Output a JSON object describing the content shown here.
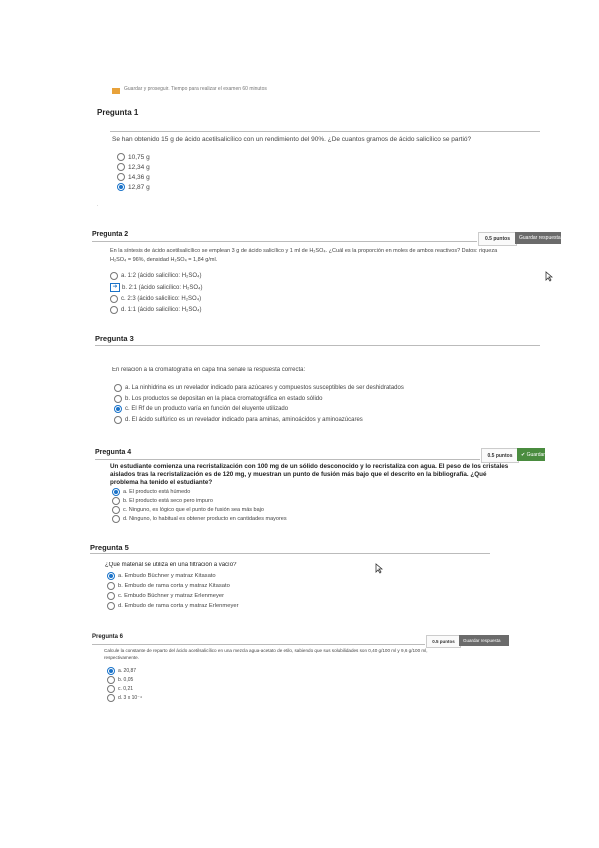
{
  "header_note": "Guardar y proseguir. Tiempo para realizar el examen 60 minutos",
  "q1": {
    "title": "Pregunta 1",
    "stem": "Se han obtenido 15 g de ácido acetilsalicílico con un rendimiento del 90%. ¿De cuantos gramos de ácido salicílico se partió?",
    "options": [
      "10,75 g",
      "12,34 g",
      "14,36 g",
      "12,87 g"
    ],
    "selected": 3
  },
  "q2": {
    "title": "Pregunta 2",
    "points": "0.5 puntos",
    "save": "Guardar respuesta",
    "stem1": "En la síntesis de ácido acetilsalicílico se emplean 3 g de ácido salicílico y 1 ml de H₂SO₄. ¿Cuál es la proporción en moles de ambos reactivos? Datos: riqueza",
    "stem2": "H₂SO₄ = 96%, densidad H₂SO₄ = 1,84 g/ml.",
    "options": [
      "a. 1:2 (ácido salicílico: H₂SO₄)",
      "b. 2:1 (ácido salicílico: H₂SO₄)",
      "c. 2:3 (ácido salicílico: H₂SO₄)",
      "d. 1:1 (ácido salicílico: H₂SO₄)"
    ],
    "selected": 1
  },
  "q3": {
    "title": "Pregunta 3",
    "stem": "En relación a la cromatografía en capa fina señale la respuesta correcta:",
    "options": [
      "a. La ninhidrina es un revelador indicado para azúcares y compuestos susceptibles de ser deshidratados",
      "b. Los productos se depositan en la placa cromatográfica en estado sólido",
      "c. El Rf de un producto varía en función del eluyente utilizado",
      "d. El ácido sulfúrico es un revelador indicado para aminas, aminoácidos y aminoazúcares"
    ],
    "selected": 2
  },
  "q4": {
    "title": "Pregunta 4",
    "points": "0.5 puntos",
    "save": "Guardar",
    "stem1": "Un estudiante comienza una recristalización con 100 mg de un sólido desconocido y lo recristaliza con agua. El peso de los cristales",
    "stem2": "aislados tras la recristalización es de 120 mg, y muestran un punto de fusión más bajo que el descrito en la bibliografía. ¿Qué",
    "stem3": "problema ha tenido el estudiante?",
    "options": [
      "a. El producto está húmedo",
      "b. El producto está seco pero impuro",
      "c. Ninguno, es lógico que el punto de fusión sea más bajo",
      "d. Ninguno, lo habitual es obtener producto en cantidades mayores"
    ],
    "selected": 0
  },
  "q5": {
    "title": "Pregunta 5",
    "stem": "¿Qué material se utiliza en una filtración a vacío?",
    "options": [
      "a. Embudo Büchner y matraz Kitasato",
      "b. Embudo de rama corta y matraz Kitasato",
      "c. Embudo Büchner y matraz Erlenmeyer",
      "d. Embudo de rama corta y matraz Erlenmeyer"
    ],
    "selected": 0
  },
  "q6": {
    "title": "Pregunta 6",
    "points": "0.5 puntos",
    "save": "Guardar respuesta",
    "stem1": "Calcule la constante de reparto del ácido acetilsalicílico en una mezcla agua-acetato de etilo, sabiendo que sus solubilidades son 0,40 g/100 ml y 9,6 g/100 ml,",
    "stem2": "respectivamente.",
    "options": [
      "a. 20,87",
      "b. 0,05",
      "c. 0,21",
      "d. 3 x 10⁻⁴"
    ],
    "selected": 0
  },
  "colors": {
    "accent": "#1a73c9",
    "save_bg": "#6b6b6b",
    "save_green": "#4a8c3f"
  }
}
